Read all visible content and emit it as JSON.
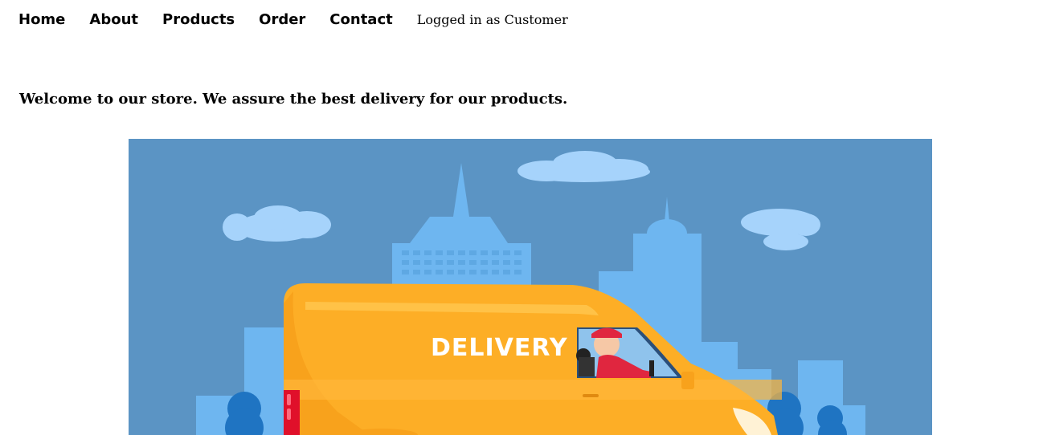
{
  "nav": {
    "items": [
      {
        "label": "Home"
      },
      {
        "label": "About"
      },
      {
        "label": "Products"
      },
      {
        "label": "Order"
      },
      {
        "label": "Contact"
      }
    ],
    "login_status": "Logged in as Customer"
  },
  "main": {
    "welcome": "Welcome to our store. We assure the best delivery for our products."
  },
  "hero": {
    "van_text": "DELIVERY",
    "colors": {
      "sky": "#5b94c4",
      "building": "#6eb6f0",
      "cloud": "#a6d3fb",
      "van": "#fdae26",
      "tree": "#1f74c2"
    }
  }
}
